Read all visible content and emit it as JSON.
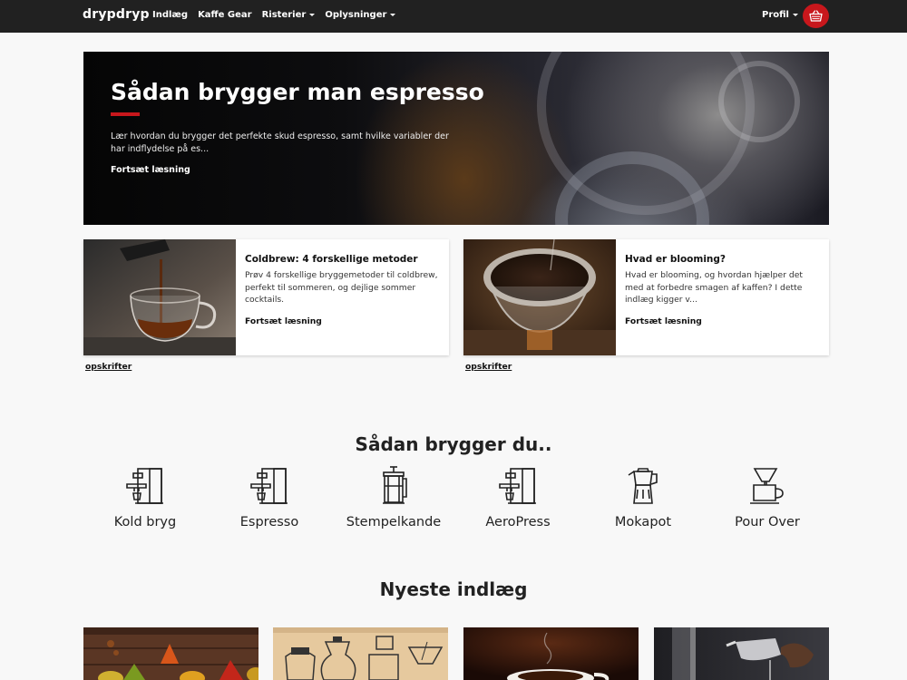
{
  "navbar": {
    "brand": "drypdryp",
    "links": [
      {
        "label": "Indlæg",
        "dropdown": false
      },
      {
        "label": "Kaffe Gear",
        "dropdown": false
      },
      {
        "label": "Risterier",
        "dropdown": true
      },
      {
        "label": "Oplysninger",
        "dropdown": true
      }
    ],
    "profile": "Profil",
    "cart_icon": "basket-icon"
  },
  "hero": {
    "title": "Sådan brygger man espresso",
    "text": "Lær hvordan du brygger det perfekte skud espresso, samt hvilke variabler der har indflydelse på es...",
    "link": "Fortsæt læsning"
  },
  "cards": [
    {
      "title": "Coldbrew: 4 forskellige metoder",
      "text": "Prøv 4 forskellige bryggemetoder til coldbrew, perfekt til sommeren, og dejlige sommer cocktails.",
      "link": "Fortsæt læsning",
      "tag": "opskrifter"
    },
    {
      "title": "Hvad er blooming?",
      "text": "Hvad er blooming, og hvordan hjælper det med at forbedre smagen af kaffen? I dette indlæg kigger v...",
      "link": "Fortsæt læsning",
      "tag": "opskrifter"
    }
  ],
  "brew_section": {
    "title": "Sådan brygger du..",
    "methods": [
      {
        "label": "Kold bryg",
        "icon": "espresso-machine-icon"
      },
      {
        "label": "Espresso",
        "icon": "espresso-machine-icon"
      },
      {
        "label": "Stempelkande",
        "icon": "french-press-icon"
      },
      {
        "label": "AeroPress",
        "icon": "espresso-machine-icon"
      },
      {
        "label": "Mokapot",
        "icon": "moka-pot-icon"
      },
      {
        "label": "Pour Over",
        "icon": "pour-over-icon"
      }
    ]
  },
  "latest": {
    "title": "Nyeste indlæg"
  },
  "colors": {
    "navbar": "#212121",
    "accent": "#c8171c",
    "background": "#f8f8f8"
  }
}
